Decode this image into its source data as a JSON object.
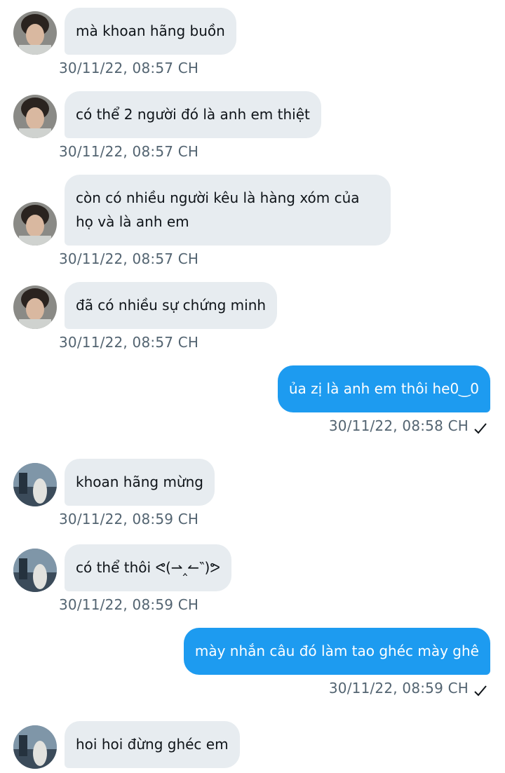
{
  "messages": [
    {
      "dir": "in",
      "avatar": "avatar-a",
      "text": "mà khoan hãng buồn",
      "time": "30/11/22,  08:57 CH"
    },
    {
      "dir": "in",
      "avatar": "avatar-a",
      "text": "có thể 2 người đó là anh em thiệt",
      "time": "30/11/22,  08:57 CH"
    },
    {
      "dir": "in",
      "avatar": "avatar-a",
      "text_line1": "còn có nhiều người kêu là hàng xóm của",
      "text_line2": "họ và là anh em",
      "time": "30/11/22,  08:57 CH"
    },
    {
      "dir": "in",
      "avatar": "avatar-a",
      "text": "đã có nhiều sự chứng minh",
      "time": "30/11/22,  08:57 CH"
    },
    {
      "dir": "out",
      "text": "ủa zị là anh em thôi he0‿0",
      "time": "30/11/22,  08:58 CH",
      "status_icon": "check-icon"
    },
    {
      "dir": "in",
      "avatar": "avatar-b",
      "text": "khoan hãng mừng",
      "time": "30/11/22,  08:59 CH"
    },
    {
      "dir": "in",
      "avatar": "avatar-b",
      "text": "có thể thôi ᕙ(⇀‸↼‶)ᕗ",
      "time": "30/11/22,  08:59 CH"
    },
    {
      "dir": "out",
      "text": "mày nhắn câu đó làm tao ghéc mày ghê",
      "time": "30/11/22,  08:59 CH",
      "status_icon": "check-icon"
    },
    {
      "dir": "in",
      "avatar": "avatar-b",
      "text": "hoi hoi đừng ghéc em"
    }
  ],
  "colors": {
    "incoming_bubble": "#e7ecf0",
    "outgoing_bubble": "#1d9bf0",
    "timestamp": "#536471",
    "text": "#0f1419"
  }
}
